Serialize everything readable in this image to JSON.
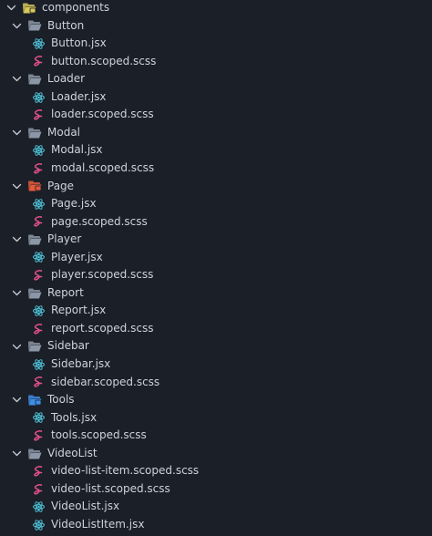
{
  "explorer": {
    "root": {
      "label": "components",
      "icon": "folder-open-special-icon",
      "color": "#d6c85a"
    },
    "folders": [
      {
        "label": "Button",
        "icon": "folder-open-icon",
        "files": [
          {
            "label": "Button.jsx",
            "icon": "react-icon"
          },
          {
            "label": "button.scoped.scss",
            "icon": "sass-icon"
          }
        ]
      },
      {
        "label": "Loader",
        "icon": "folder-open-icon",
        "files": [
          {
            "label": "Loader.jsx",
            "icon": "react-icon"
          },
          {
            "label": "loader.scoped.scss",
            "icon": "sass-icon"
          }
        ]
      },
      {
        "label": "Modal",
        "icon": "folder-open-icon",
        "files": [
          {
            "label": "Modal.jsx",
            "icon": "react-icon"
          },
          {
            "label": "modal.scoped.scss",
            "icon": "sass-icon"
          }
        ]
      },
      {
        "label": "Page",
        "icon": "folder-open-special-icon",
        "color": "#e35a3c",
        "files": [
          {
            "label": "Page.jsx",
            "icon": "react-icon"
          },
          {
            "label": "page.scoped.scss",
            "icon": "sass-icon"
          }
        ]
      },
      {
        "label": "Player",
        "icon": "folder-open-icon",
        "files": [
          {
            "label": "Player.jsx",
            "icon": "react-icon"
          },
          {
            "label": "player.scoped.scss",
            "icon": "sass-icon"
          }
        ]
      },
      {
        "label": "Report",
        "icon": "folder-open-icon",
        "files": [
          {
            "label": "Report.jsx",
            "icon": "react-icon"
          },
          {
            "label": "report.scoped.scss",
            "icon": "sass-icon"
          }
        ]
      },
      {
        "label": "Sidebar",
        "icon": "folder-open-icon",
        "files": [
          {
            "label": "Sidebar.jsx",
            "icon": "react-icon"
          },
          {
            "label": "sidebar.scoped.scss",
            "icon": "sass-icon"
          }
        ]
      },
      {
        "label": "Tools",
        "icon": "folder-open-special-icon",
        "color": "#3d8ee6",
        "files": [
          {
            "label": "Tools.jsx",
            "icon": "react-icon"
          },
          {
            "label": "tools.scoped.scss",
            "icon": "sass-icon"
          }
        ]
      },
      {
        "label": "VideoList",
        "icon": "folder-open-icon",
        "files": [
          {
            "label": "video-list-item.scoped.scss",
            "icon": "sass-icon"
          },
          {
            "label": "video-list.scoped.scss",
            "icon": "sass-icon"
          },
          {
            "label": "VideoList.jsx",
            "icon": "react-icon"
          },
          {
            "label": "VideoListItem.jsx",
            "icon": "react-icon"
          }
        ]
      }
    ]
  },
  "colors": {
    "background": "#1b1f27",
    "text": "#cdd3de",
    "folder": "#8b96a6",
    "react": "#4fc3d9",
    "sass": "#e0508a",
    "chevron": "#c8ccd4"
  }
}
